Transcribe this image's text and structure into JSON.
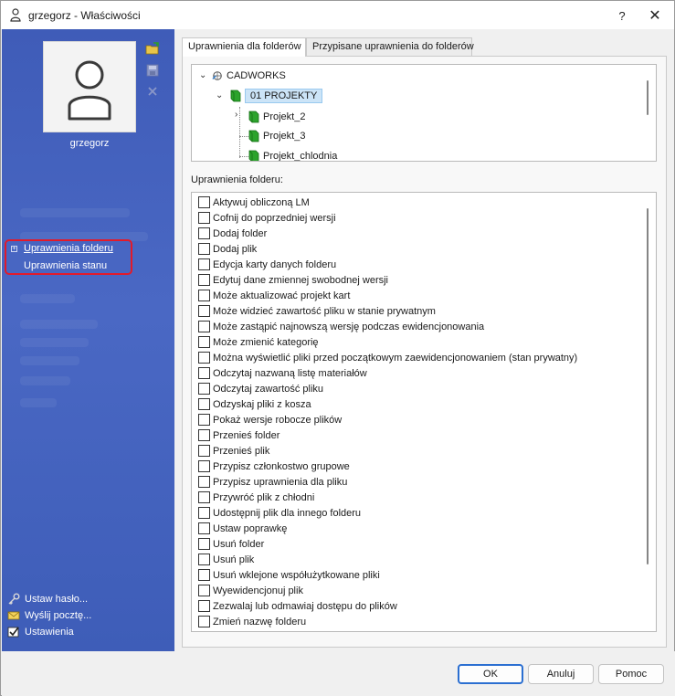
{
  "window": {
    "title": "grzegorz - Właściwości",
    "help_label": "?",
    "close_label": "✕"
  },
  "sidebar": {
    "username": "grzegorz",
    "nav": [
      {
        "label": "Uprawnienia folderu",
        "active": true
      },
      {
        "label": "Uprawnienia stanu",
        "active": false
      }
    ],
    "links": [
      {
        "label": "Ustaw hasło...",
        "icon": "key-icon"
      },
      {
        "label": "Wyślij pocztę...",
        "icon": "mail-icon"
      },
      {
        "label": "Ustawienia",
        "icon": "settings-checkbox-icon"
      }
    ],
    "colors": {
      "panel": "#4563bf",
      "highlight_border": "#e21a2a"
    }
  },
  "tabs": [
    {
      "label": "Uprawnienia dla folderów",
      "active": true
    },
    {
      "label": "Przypisane uprawnienia do folderów",
      "active": false
    }
  ],
  "tree": {
    "items": [
      {
        "label": "CADWORKS",
        "level": 0,
        "expanded": true,
        "icon": "vault-root-icon"
      },
      {
        "label": "01 PROJEKTY",
        "level": 1,
        "expanded": true,
        "selected": true,
        "icon": "folder-icon"
      },
      {
        "label": "Projekt_2",
        "level": 2,
        "expandable": true,
        "icon": "folder-icon"
      },
      {
        "label": "Projekt_3",
        "level": 2,
        "icon": "folder-icon"
      },
      {
        "label": "Projekt_chlodnia",
        "level": 2,
        "icon": "folder-icon"
      }
    ]
  },
  "permissions": {
    "heading": "Uprawnienia folderu:",
    "items": [
      "Aktywuj obliczoną LM",
      "Cofnij do poprzedniej wersji",
      "Dodaj folder",
      "Dodaj plik",
      "Edycja karty danych folderu",
      "Edytuj dane zmiennej swobodnej wersji",
      "Może aktualizować projekt kart",
      "Może widzieć zawartość pliku w stanie prywatnym",
      "Może zastąpić najnowszą wersję podczas ewidencjonowania",
      "Może zmienić kategorię",
      "Można wyświetlić pliki przed początkowym zaewidencjonowaniem (stan prywatny)",
      "Odczytaj nazwaną listę materiałów",
      "Odczytaj zawartość pliku",
      "Odzyskaj pliki z kosza",
      "Pokaż wersje robocze plików",
      "Przenieś folder",
      "Przenieś plik",
      "Przypisz członkostwo grupowe",
      "Przypisz uprawnienia dla pliku",
      "Przywróć plik z chłodni",
      "Udostępnij plik dla innego folderu",
      "Ustaw poprawkę",
      "Usuń folder",
      "Usuń plik",
      "Usuń wklejone współużytkowane  pliki",
      "Wyewidencjonuj plik",
      "Zezwalaj lub odmawiaj dostępu do plików",
      "Zmień nazwę folderu"
    ]
  },
  "buttons": {
    "ok": "OK",
    "cancel": "Anuluj",
    "help": "Pomoc"
  }
}
